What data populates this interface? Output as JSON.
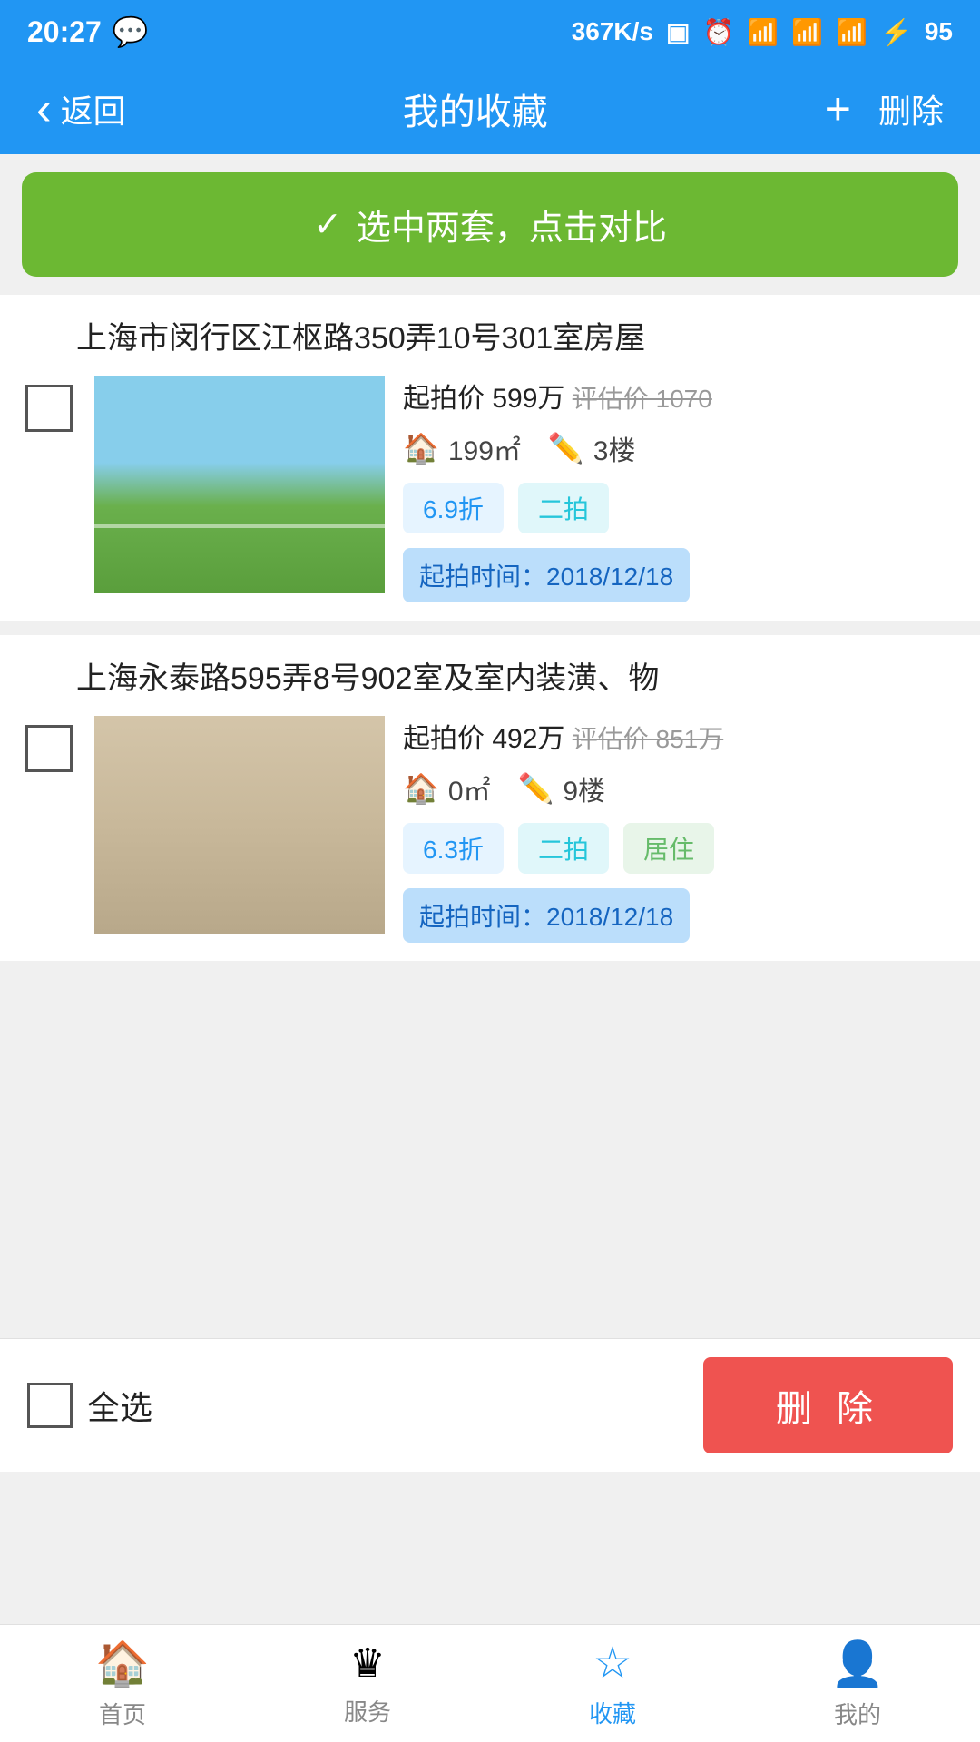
{
  "statusBar": {
    "time": "20:27",
    "networkSpeed": "367K/s",
    "battery": "95"
  },
  "navBar": {
    "backLabel": "返回",
    "title": "我的收藏",
    "addLabel": "+",
    "deleteLabel": "删除"
  },
  "compareBanner": {
    "checkmark": "✓",
    "label": "选中两套，点击对比"
  },
  "properties": [
    {
      "id": "prop-1",
      "title": "上海市闵行区江枢路350弄10号301室房屋",
      "startPrice": "起拍价 599万",
      "estPriceLabel": "评估价 1070",
      "area": "199㎡",
      "floor": "3楼",
      "tags": [
        "6.9折",
        "二拍"
      ],
      "startTime": "起拍时间：2018/12/18"
    },
    {
      "id": "prop-2",
      "title": "上海永泰路595弄8号902室及室内装潢、物",
      "startPrice": "起拍价 492万",
      "estPriceLabel": "评估价 851万",
      "area": "0㎡",
      "floor": "9楼",
      "tags": [
        "6.3折",
        "二拍",
        "居住"
      ],
      "startTime": "起拍时间：2018/12/18"
    }
  ],
  "bottomBar": {
    "selectAllLabel": "全选",
    "deleteLabel": "删 除"
  },
  "tabBar": {
    "tabs": [
      {
        "id": "home",
        "icon": "🏠",
        "label": "首页",
        "active": false
      },
      {
        "id": "service",
        "icon": "♛",
        "label": "服务",
        "active": false
      },
      {
        "id": "favorites",
        "icon": "☆",
        "label": "收藏",
        "active": true
      },
      {
        "id": "mine",
        "icon": "👤",
        "label": "我的",
        "active": false
      }
    ]
  }
}
